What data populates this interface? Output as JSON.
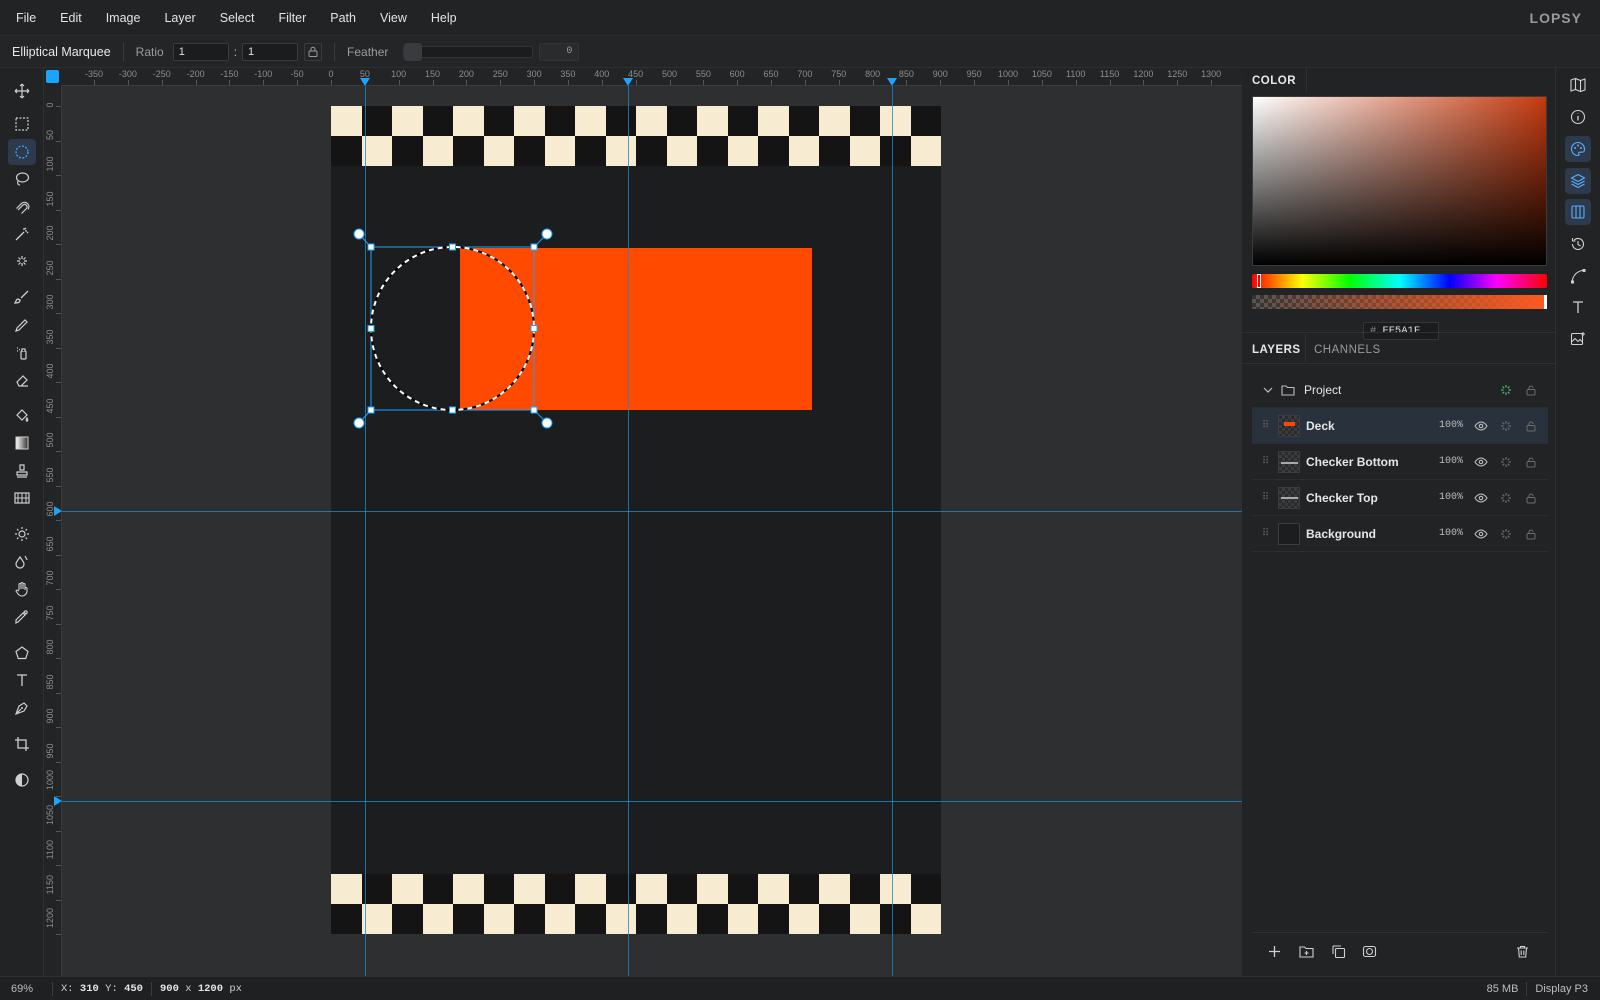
{
  "app": {
    "brand": "LOPSY"
  },
  "menu": [
    "File",
    "Edit",
    "Image",
    "Layer",
    "Select",
    "Filter",
    "Path",
    "View",
    "Help"
  ],
  "options": {
    "tool_name": "Elliptical Marquee",
    "ratio_label": "Ratio",
    "ratio_w": "1",
    "ratio_h": "1",
    "colon": ":",
    "feather_label": "Feather",
    "feather_value": "0"
  },
  "rulers": {
    "top": [
      "-350",
      "-300",
      "-250",
      "-200",
      "-150",
      "-100",
      "-50",
      "0",
      "50",
      "100",
      "150",
      "200",
      "250",
      "300",
      "350",
      "400",
      "450",
      "500",
      "550",
      "600",
      "650",
      "700",
      "750",
      "800",
      "850",
      "900",
      "950",
      "1000",
      "1050",
      "1100",
      "1150",
      "1200",
      "1250",
      "1300"
    ],
    "left": [
      "0",
      "50",
      "100",
      "150",
      "200",
      "250",
      "300",
      "350",
      "400",
      "450",
      "500",
      "550",
      "600",
      "650",
      "700",
      "750",
      "800",
      "850",
      "900",
      "950",
      "1000",
      "1050",
      "1100",
      "1150",
      "1200"
    ]
  },
  "color_panel": {
    "title": "COLOR",
    "hex_prefix": "#",
    "hex": "FF5A1F",
    "accent": "#ff4a00"
  },
  "layers_panel": {
    "tab_layers": "LAYERS",
    "tab_channels": "CHANNELS",
    "group": "Project",
    "layers": [
      {
        "name": "Deck",
        "opacity": "100%"
      },
      {
        "name": "Checker Bottom",
        "opacity": "100%"
      },
      {
        "name": "Checker Top",
        "opacity": "100%"
      },
      {
        "name": "Background",
        "opacity": "100%"
      }
    ]
  },
  "status": {
    "zoom": "69%",
    "x_label": "X:",
    "x": "310",
    "y_label": "Y:",
    "y": "450",
    "doc_w": "900",
    "doc_x": "x",
    "doc_h": "1200",
    "doc_unit": "px",
    "memory": "85 MB",
    "profile": "Display P3"
  },
  "colors": {
    "selection": "#1aa3ff",
    "checker_light": "#f7ebd2",
    "checker_dark": "#141414",
    "deck": "#ff4a00"
  }
}
